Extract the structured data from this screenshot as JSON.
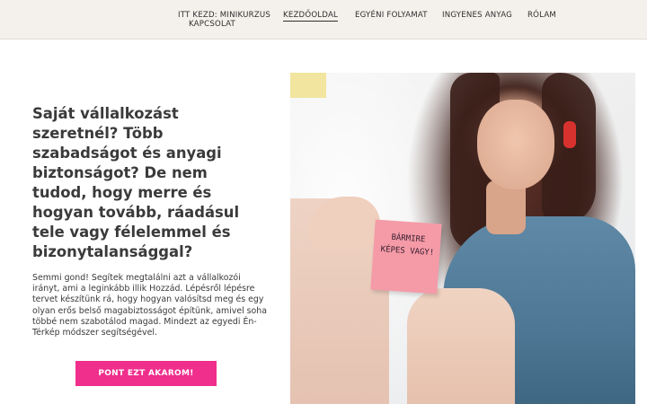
{
  "nav": {
    "items": [
      {
        "label": "ITT KEZD: MINIKURZUS",
        "active": false
      },
      {
        "label": "KEZDŐOLDAL",
        "active": true
      },
      {
        "label": "EGYÉNI FOLYAMAT",
        "active": false
      },
      {
        "label": "INGYENES ANYAG",
        "active": false
      },
      {
        "label": "RÓLAM",
        "active": false
      },
      {
        "label": "KAPCSOLAT",
        "active": false
      }
    ]
  },
  "hero": {
    "headline": "Saját vállalkozást szeretnél? Több szabadságot és anyagi biztonságot? De nem tudod, hogy merre és hogyan tovább, ráadásul tele vagy félelemmel és bizonytalansággal?",
    "body": "Semmi gond! Segítek megtalálni azt a vállalkozói irányt, ami a leginkább illik Hozzád. Lépésről lépésre tervet készítünk rá, hogy hogyan valósítsd meg és egy olyan erős belső magabiztosságot építünk, amivel soha többé nem szabotálod magad. Mindezt az egyedi Én-Térkép módszer segítségével.",
    "cta_label": "PONT EZT AKAROM!",
    "cta_color": "#f02e8c"
  },
  "photo": {
    "sticky_note_text": "Bármire képes vagy!"
  },
  "colors": {
    "topbar_bg": "#f4f0ec",
    "accent": "#f02e8c",
    "text": "#3a3a3a"
  }
}
